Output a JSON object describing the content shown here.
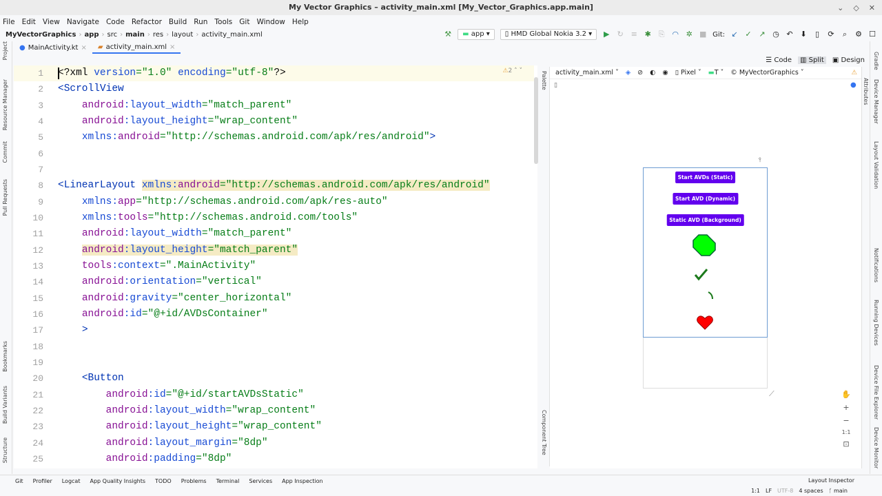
{
  "window": {
    "title": "My Vector Graphics – activity_main.xml [My_Vector_Graphics.app.main]"
  },
  "menu": [
    "File",
    "Edit",
    "View",
    "Navigate",
    "Code",
    "Refactor",
    "Build",
    "Run",
    "Tools",
    "Git",
    "Window",
    "Help"
  ],
  "breadcrumb": [
    "MyVectorGraphics",
    "app",
    "src",
    "main",
    "res",
    "layout",
    "activity_main.xml"
  ],
  "toolbar": {
    "config": "app",
    "device": "HMD Global Nokia 3.2",
    "git_label": "Git:"
  },
  "tabs": [
    {
      "label": "MainActivity.kt"
    },
    {
      "label": "activity_main.xml",
      "active": true
    }
  ],
  "editor": {
    "warnings": "2",
    "lines": [
      [
        {
          "c": "pl",
          "v": "<?xml "
        },
        {
          "c": "attr",
          "v": "version"
        },
        {
          "c": "val",
          "v": "=\"1.0\" "
        },
        {
          "c": "attr",
          "v": "encoding"
        },
        {
          "c": "val",
          "v": "=\"utf-8\""
        },
        {
          "c": "pl",
          "v": "?>"
        }
      ],
      [
        {
          "c": "tag",
          "v": "<ScrollView"
        }
      ],
      [
        {
          "c": "pl",
          "v": "    "
        },
        {
          "c": "ns",
          "v": "android"
        },
        {
          "c": "attr",
          "v": ":layout_width"
        },
        {
          "c": "val",
          "v": "=\"match_parent\""
        }
      ],
      [
        {
          "c": "pl",
          "v": "    "
        },
        {
          "c": "ns",
          "v": "android"
        },
        {
          "c": "attr",
          "v": ":layout_height"
        },
        {
          "c": "val",
          "v": "=\"wrap_content\""
        }
      ],
      [
        {
          "c": "pl",
          "v": "    "
        },
        {
          "c": "attr",
          "v": "xmlns:"
        },
        {
          "c": "ns",
          "v": "android"
        },
        {
          "c": "val",
          "v": "=\"http://schemas.android.com/apk/res/android\""
        },
        {
          "c": "tag",
          "v": ">"
        }
      ],
      [],
      [],
      [
        {
          "c": "tag",
          "v": "<LinearLayout "
        },
        {
          "c": "attr",
          "v": "xmlns:",
          "hl": true
        },
        {
          "c": "ns",
          "v": "android",
          "hl": true
        },
        {
          "c": "val",
          "v": "=\"http://schemas.android.com/apk/res/android\"",
          "hl": true
        }
      ],
      [
        {
          "c": "pl",
          "v": "    "
        },
        {
          "c": "attr",
          "v": "xmlns:"
        },
        {
          "c": "ns",
          "v": "app"
        },
        {
          "c": "val",
          "v": "=\"http://schemas.android.com/apk/res-auto\""
        }
      ],
      [
        {
          "c": "pl",
          "v": "    "
        },
        {
          "c": "attr",
          "v": "xmlns:"
        },
        {
          "c": "ns",
          "v": "tools"
        },
        {
          "c": "val",
          "v": "=\"http://schemas.android.com/tools\""
        }
      ],
      [
        {
          "c": "pl",
          "v": "    "
        },
        {
          "c": "ns",
          "v": "android"
        },
        {
          "c": "attr",
          "v": ":layout_width"
        },
        {
          "c": "val",
          "v": "=\"match_parent\""
        }
      ],
      [
        {
          "c": "pl",
          "v": "    "
        },
        {
          "c": "ns",
          "v": "android",
          "hl": true
        },
        {
          "c": "attr",
          "v": ":layout_height",
          "hl": true
        },
        {
          "c": "val",
          "v": "=\"match_parent\"",
          "hl": true
        }
      ],
      [
        {
          "c": "pl",
          "v": "    "
        },
        {
          "c": "ns",
          "v": "tools"
        },
        {
          "c": "attr",
          "v": ":context"
        },
        {
          "c": "val",
          "v": "=\".MainActivity\""
        }
      ],
      [
        {
          "c": "pl",
          "v": "    "
        },
        {
          "c": "ns",
          "v": "android"
        },
        {
          "c": "attr",
          "v": ":orientation"
        },
        {
          "c": "val",
          "v": "=\"vertical\""
        }
      ],
      [
        {
          "c": "pl",
          "v": "    "
        },
        {
          "c": "ns",
          "v": "android"
        },
        {
          "c": "attr",
          "v": ":gravity"
        },
        {
          "c": "val",
          "v": "=\"center_horizontal\""
        }
      ],
      [
        {
          "c": "pl",
          "v": "    "
        },
        {
          "c": "ns",
          "v": "android"
        },
        {
          "c": "attr",
          "v": ":id"
        },
        {
          "c": "val",
          "v": "=\"@+id/AVDsContainer\""
        }
      ],
      [
        {
          "c": "pl",
          "v": "    "
        },
        {
          "c": "tag",
          "v": ">"
        }
      ],
      [],
      [],
      [
        {
          "c": "pl",
          "v": "    "
        },
        {
          "c": "tag",
          "v": "<Button"
        }
      ],
      [
        {
          "c": "pl",
          "v": "        "
        },
        {
          "c": "ns",
          "v": "android"
        },
        {
          "c": "attr",
          "v": ":id"
        },
        {
          "c": "val",
          "v": "=\"@+id/startAVDsStatic\""
        }
      ],
      [
        {
          "c": "pl",
          "v": "        "
        },
        {
          "c": "ns",
          "v": "android"
        },
        {
          "c": "attr",
          "v": ":layout_width"
        },
        {
          "c": "val",
          "v": "=\"wrap_content\""
        }
      ],
      [
        {
          "c": "pl",
          "v": "        "
        },
        {
          "c": "ns",
          "v": "android"
        },
        {
          "c": "attr",
          "v": ":layout_height"
        },
        {
          "c": "val",
          "v": "=\"wrap_content\""
        }
      ],
      [
        {
          "c": "pl",
          "v": "        "
        },
        {
          "c": "ns",
          "v": "android"
        },
        {
          "c": "attr",
          "v": ":layout_margin"
        },
        {
          "c": "val",
          "v": "=\"8dp\""
        }
      ],
      [
        {
          "c": "pl",
          "v": "        "
        },
        {
          "c": "ns",
          "v": "android"
        },
        {
          "c": "attr",
          "v": ":padding"
        },
        {
          "c": "val",
          "v": "=\"8dp\""
        }
      ]
    ]
  },
  "view_modes": [
    "Code",
    "Split",
    "Design"
  ],
  "design": {
    "file": "activity_main.xml",
    "device": "Pixel",
    "api": "T",
    "theme": "MyVectorGraphics",
    "buttons": [
      "Start AVDs (Static)",
      "Start AVD (Dynamic)",
      "Static AVD (Background)"
    ]
  },
  "left_tools": [
    "Project",
    "Resource Manager",
    "Commit",
    "Pull Requests",
    "Bookmarks",
    "Build Variants",
    "Structure"
  ],
  "right_tools": [
    "Gradle",
    "Device Manager",
    "Layout Validation",
    "Notifications",
    "Running Devices",
    "Device File Explorer",
    "Device Monitor"
  ],
  "side_panels": {
    "palette": "Palette",
    "component_tree": "Component Tree",
    "attributes": "Attributes"
  },
  "bottom_tools": [
    "Git",
    "Profiler",
    "Logcat",
    "App Quality Insights",
    "TODO",
    "Problems",
    "Terminal",
    "Services",
    "App Inspection"
  ],
  "bottom_right": "Layout Inspector",
  "status": {
    "position": "1:1",
    "line_sep": "LF",
    "encoding": "UTF-8",
    "indent": "4 spaces",
    "branch": "main"
  },
  "colors": {
    "accent": "#3574f0",
    "button": "#6200ee"
  }
}
